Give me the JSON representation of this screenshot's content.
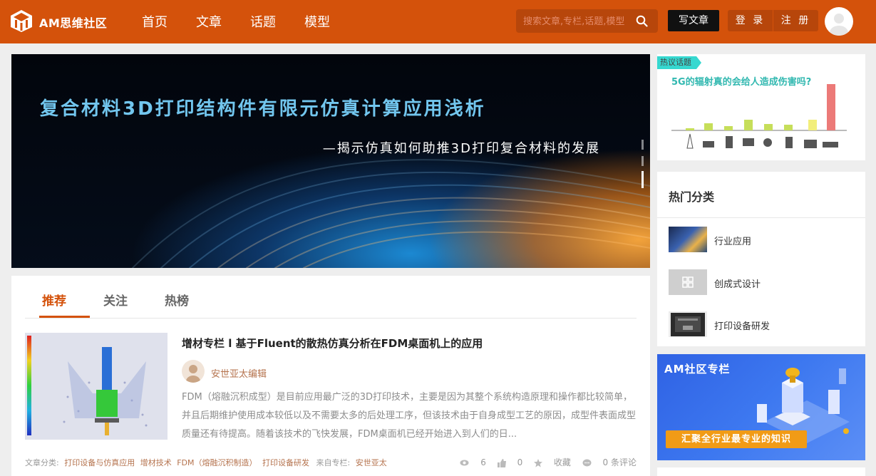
{
  "header": {
    "brand": "AM思维社区",
    "nav": [
      "首页",
      "文章",
      "话题",
      "模型"
    ],
    "search_placeholder": "搜索文章,专栏,话题,模型",
    "write_label": "写文章",
    "login_label": "登 录",
    "register_label": "注 册"
  },
  "banner": {
    "title": "复合材料3D打印结构件有限元仿真计算应用浅析",
    "subtitle": "—揭示仿真如何助推3D打印复合材料的发展"
  },
  "feed": {
    "tabs": [
      "推荐",
      "关注",
      "热榜"
    ],
    "article": {
      "title": "增材专栏 l 基于Fluent的散热仿真分析在FDM桌面机上的应用",
      "author": "安世亚太编辑",
      "excerpt": "FDM（熔融沉积成型）是目前应用最广泛的3D打印技术，主要是因为其整个系统构造原理和操作都比较简单，并且后期维护使用成本较低以及不需要太多的后处理工序，但该技术由于自身成型工艺的原因，成型件表面成型质量还有待提高。随着该技术的飞快发展，FDM桌面机已经开始进入到人们的日...",
      "category_label": "文章分类:",
      "tags": [
        "打印设备与仿真应用",
        "增材技术",
        "FDM（熔融沉积制造）",
        "打印设备研发"
      ],
      "from_label": "来自专栏:",
      "from_column": "安世亚太",
      "views": "6",
      "likes": "0",
      "favorite_label": "收藏",
      "comments_label": "0 条评论"
    }
  },
  "sidebar": {
    "hot_topic": {
      "badge": "热议话题",
      "question": "5G的辐射真的会给人造成伤害吗?"
    },
    "categories_title": "热门分类",
    "categories": [
      "行业应用",
      "创成式设计",
      "打印设备研发"
    ],
    "column": {
      "title": "AM社区专栏",
      "slogan": "汇聚全行业最专业的知识"
    }
  },
  "colors": {
    "brand": "#d4520b",
    "brand_dark": "#b7460b",
    "link": "#b5734e",
    "topic": "#31b8b0"
  }
}
